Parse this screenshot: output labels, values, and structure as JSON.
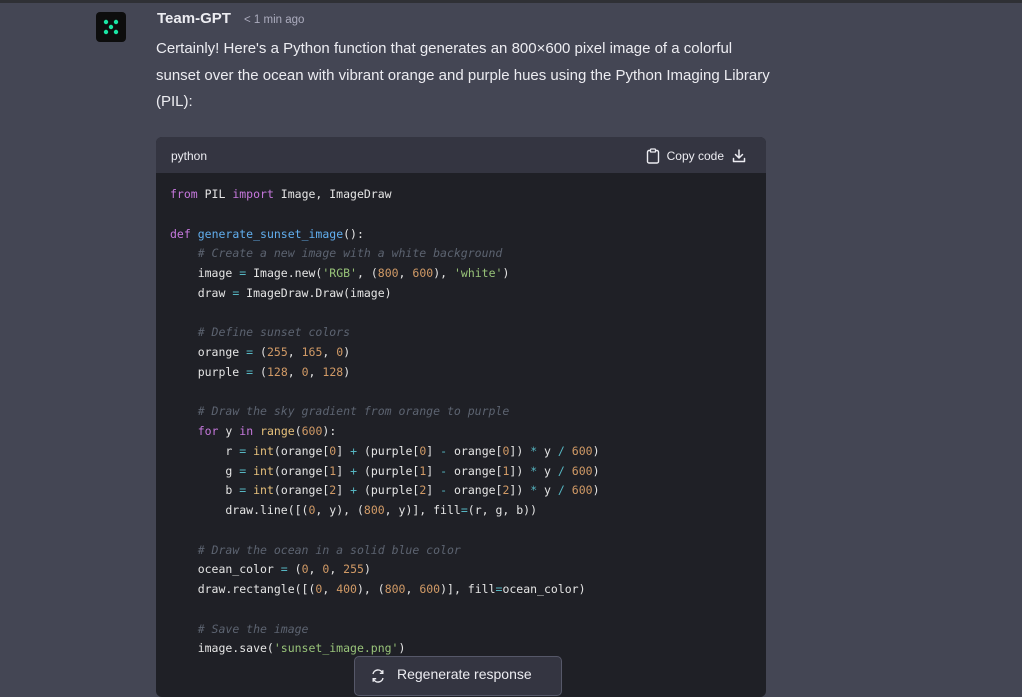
{
  "message": {
    "author": "Team-GPT",
    "timestamp": "< 1 min ago",
    "text": "Certainly! Here's a Python function that generates an 800×600 pixel image of a colorful sunset over the ocean with vibrant orange and purple hues using the Python Imaging Library (PIL):"
  },
  "code_block": {
    "language": "python",
    "copy_label": "Copy code",
    "lines": [
      [
        [
          "kw",
          "from"
        ],
        [
          "t",
          " PIL "
        ],
        [
          "kw",
          "import"
        ],
        [
          "t",
          " Image, ImageDraw"
        ]
      ],
      [],
      [
        [
          "kw",
          "def"
        ],
        [
          "t",
          " "
        ],
        [
          "fn",
          "generate_sunset_image"
        ],
        [
          "t",
          "():"
        ]
      ],
      [
        [
          "t",
          "    "
        ],
        [
          "cm",
          "# Create a new image with a white background"
        ]
      ],
      [
        [
          "t",
          "    image "
        ],
        [
          "op",
          "="
        ],
        [
          "t",
          " Image.new("
        ],
        [
          "str",
          "'RGB'"
        ],
        [
          "t",
          ", ("
        ],
        [
          "num",
          "800"
        ],
        [
          "t",
          ", "
        ],
        [
          "num",
          "600"
        ],
        [
          "t",
          "), "
        ],
        [
          "str",
          "'white'"
        ],
        [
          "t",
          ")"
        ]
      ],
      [
        [
          "t",
          "    draw "
        ],
        [
          "op",
          "="
        ],
        [
          "t",
          " ImageDraw.Draw(image)"
        ]
      ],
      [],
      [
        [
          "t",
          "    "
        ],
        [
          "cm",
          "# Define sunset colors"
        ]
      ],
      [
        [
          "t",
          "    orange "
        ],
        [
          "op",
          "="
        ],
        [
          "t",
          " ("
        ],
        [
          "num",
          "255"
        ],
        [
          "t",
          ", "
        ],
        [
          "num",
          "165"
        ],
        [
          "t",
          ", "
        ],
        [
          "num",
          "0"
        ],
        [
          "t",
          ")"
        ]
      ],
      [
        [
          "t",
          "    purple "
        ],
        [
          "op",
          "="
        ],
        [
          "t",
          " ("
        ],
        [
          "num",
          "128"
        ],
        [
          "t",
          ", "
        ],
        [
          "num",
          "0"
        ],
        [
          "t",
          ", "
        ],
        [
          "num",
          "128"
        ],
        [
          "t",
          ")"
        ]
      ],
      [],
      [
        [
          "t",
          "    "
        ],
        [
          "cm",
          "# Draw the sky gradient from orange to purple"
        ]
      ],
      [
        [
          "t",
          "    "
        ],
        [
          "kw",
          "for"
        ],
        [
          "t",
          " y "
        ],
        [
          "kw",
          "in"
        ],
        [
          "t",
          " "
        ],
        [
          "bi",
          "range"
        ],
        [
          "t",
          "("
        ],
        [
          "num",
          "600"
        ],
        [
          "t",
          "):"
        ]
      ],
      [
        [
          "t",
          "        r "
        ],
        [
          "op",
          "="
        ],
        [
          "t",
          " "
        ],
        [
          "bi",
          "int"
        ],
        [
          "t",
          "(orange["
        ],
        [
          "num",
          "0"
        ],
        [
          "t",
          "] "
        ],
        [
          "op",
          "+"
        ],
        [
          "t",
          " (purple["
        ],
        [
          "num",
          "0"
        ],
        [
          "t",
          "] "
        ],
        [
          "op",
          "-"
        ],
        [
          "t",
          " orange["
        ],
        [
          "num",
          "0"
        ],
        [
          "t",
          "]) "
        ],
        [
          "op",
          "*"
        ],
        [
          "t",
          " y "
        ],
        [
          "op",
          "/"
        ],
        [
          "t",
          " "
        ],
        [
          "num",
          "600"
        ],
        [
          "t",
          ")"
        ]
      ],
      [
        [
          "t",
          "        g "
        ],
        [
          "op",
          "="
        ],
        [
          "t",
          " "
        ],
        [
          "bi",
          "int"
        ],
        [
          "t",
          "(orange["
        ],
        [
          "num",
          "1"
        ],
        [
          "t",
          "] "
        ],
        [
          "op",
          "+"
        ],
        [
          "t",
          " (purple["
        ],
        [
          "num",
          "1"
        ],
        [
          "t",
          "] "
        ],
        [
          "op",
          "-"
        ],
        [
          "t",
          " orange["
        ],
        [
          "num",
          "1"
        ],
        [
          "t",
          "]) "
        ],
        [
          "op",
          "*"
        ],
        [
          "t",
          " y "
        ],
        [
          "op",
          "/"
        ],
        [
          "t",
          " "
        ],
        [
          "num",
          "600"
        ],
        [
          "t",
          ")"
        ]
      ],
      [
        [
          "t",
          "        b "
        ],
        [
          "op",
          "="
        ],
        [
          "t",
          " "
        ],
        [
          "bi",
          "int"
        ],
        [
          "t",
          "(orange["
        ],
        [
          "num",
          "2"
        ],
        [
          "t",
          "] "
        ],
        [
          "op",
          "+"
        ],
        [
          "t",
          " (purple["
        ],
        [
          "num",
          "2"
        ],
        [
          "t",
          "] "
        ],
        [
          "op",
          "-"
        ],
        [
          "t",
          " orange["
        ],
        [
          "num",
          "2"
        ],
        [
          "t",
          "]) "
        ],
        [
          "op",
          "*"
        ],
        [
          "t",
          " y "
        ],
        [
          "op",
          "/"
        ],
        [
          "t",
          " "
        ],
        [
          "num",
          "600"
        ],
        [
          "t",
          ")"
        ]
      ],
      [
        [
          "t",
          "        draw.line([("
        ],
        [
          "num",
          "0"
        ],
        [
          "t",
          ", y), ("
        ],
        [
          "num",
          "800"
        ],
        [
          "t",
          ", y)], fill"
        ],
        [
          "op",
          "="
        ],
        [
          "t",
          "(r, g, b))"
        ]
      ],
      [],
      [
        [
          "t",
          "    "
        ],
        [
          "cm",
          "# Draw the ocean in a solid blue color"
        ]
      ],
      [
        [
          "t",
          "    ocean_color "
        ],
        [
          "op",
          "="
        ],
        [
          "t",
          " ("
        ],
        [
          "num",
          "0"
        ],
        [
          "t",
          ", "
        ],
        [
          "num",
          "0"
        ],
        [
          "t",
          ", "
        ],
        [
          "num",
          "255"
        ],
        [
          "t",
          ")"
        ]
      ],
      [
        [
          "t",
          "    draw.rectangle([("
        ],
        [
          "num",
          "0"
        ],
        [
          "t",
          ", "
        ],
        [
          "num",
          "400"
        ],
        [
          "t",
          "), ("
        ],
        [
          "num",
          "800"
        ],
        [
          "t",
          ", "
        ],
        [
          "num",
          "600"
        ],
        [
          "t",
          ")], fill"
        ],
        [
          "op",
          "="
        ],
        [
          "t",
          "ocean_color)"
        ]
      ],
      [],
      [
        [
          "t",
          "    "
        ],
        [
          "cm",
          "# Save the image"
        ]
      ],
      [
        [
          "t",
          "    image.save("
        ],
        [
          "str",
          "'sunset_image.png'"
        ],
        [
          "t",
          ")"
        ]
      ]
    ]
  },
  "regenerate_label": "Regenerate response",
  "icons": {
    "avatar": "team-gpt-logo-icon",
    "copy": "clipboard-icon",
    "download": "download-icon",
    "regenerate": "refresh-icon"
  },
  "colors": {
    "background": "#444654",
    "code_background": "#1f2026",
    "code_header": "#343541",
    "logo_dots": "#19e6a4"
  }
}
